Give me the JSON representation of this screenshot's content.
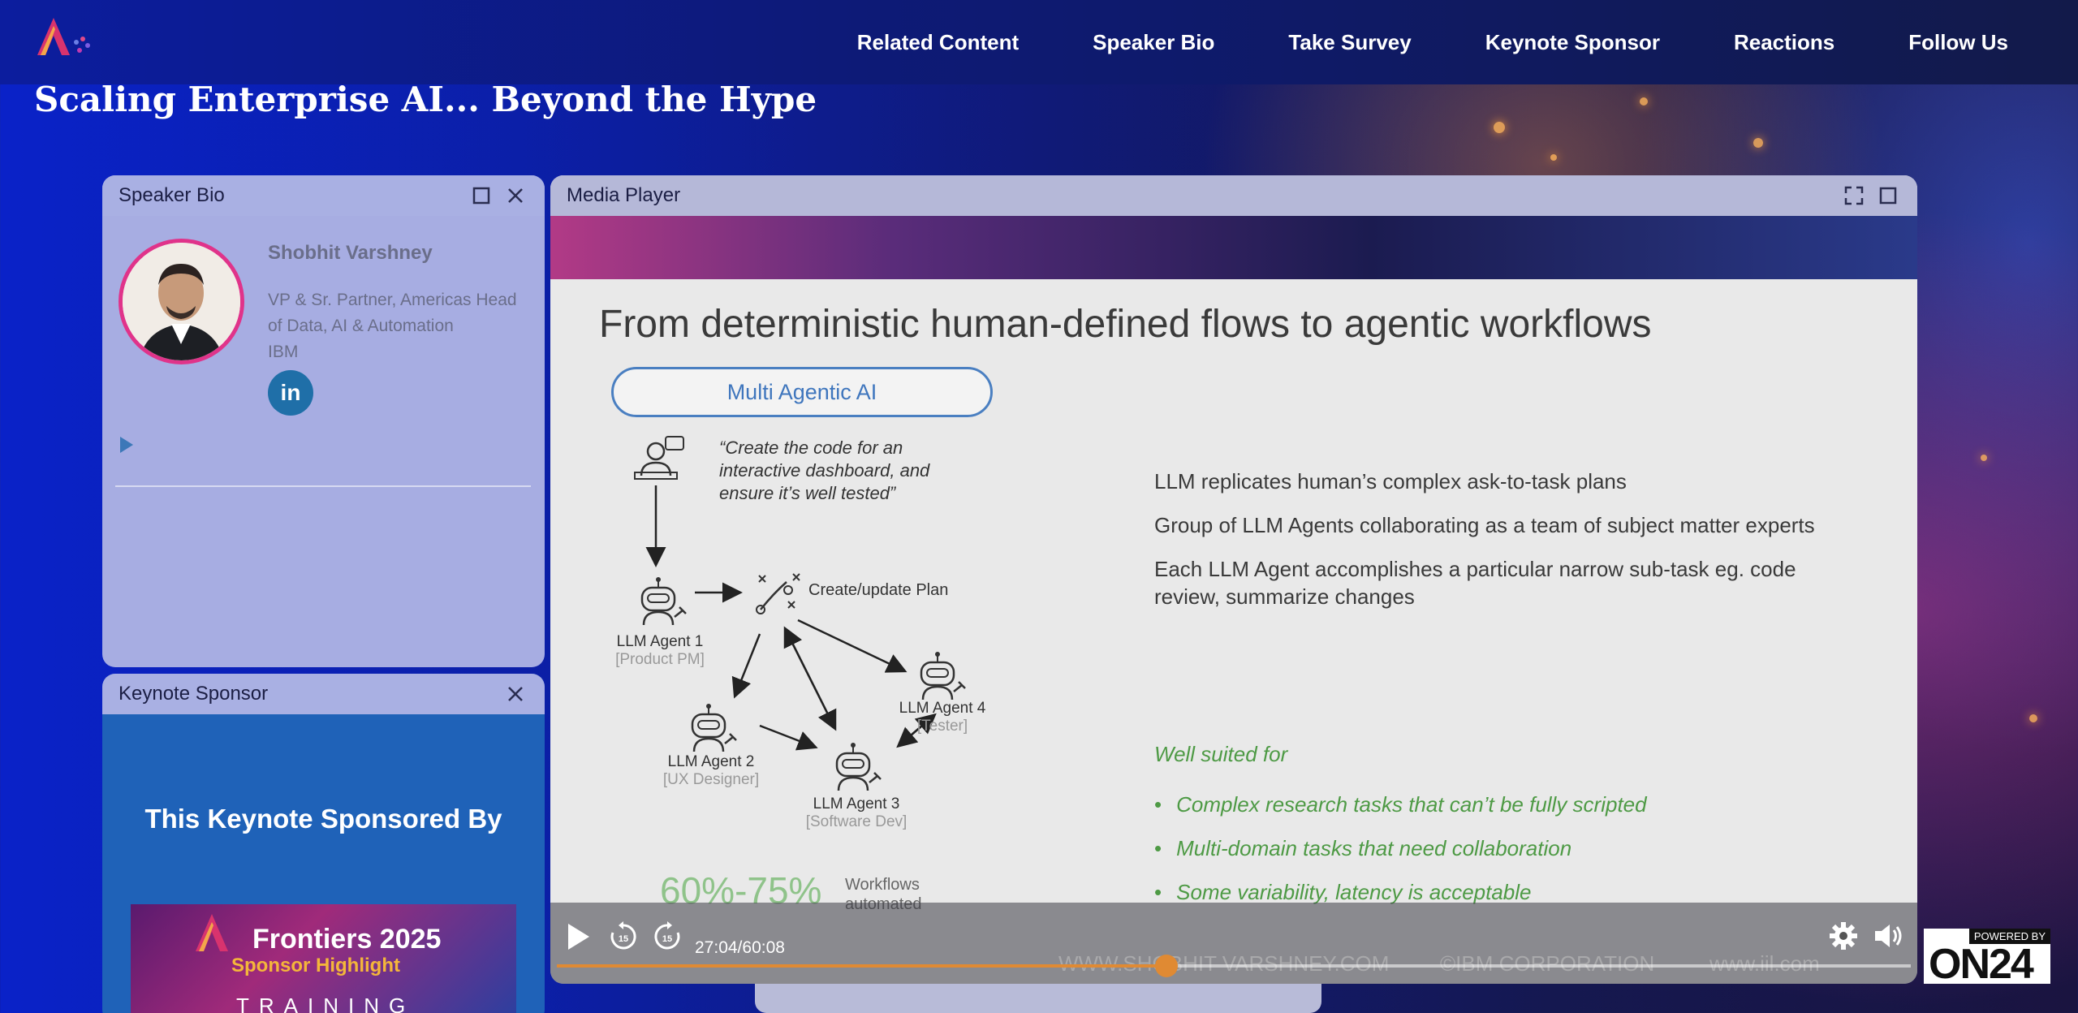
{
  "nav": {
    "items": [
      "Related Content",
      "Speaker Bio",
      "Take Survey",
      "Keynote Sponsor",
      "Reactions",
      "Follow Us"
    ],
    "logo_icon": "ai-frontiers-logo"
  },
  "page_title": "Scaling Enterprise AI... Beyond the Hype",
  "speaker_panel": {
    "title": "Speaker Bio",
    "name": "Shobhit Varshney",
    "role": "VP & Sr. Partner, Americas Head of Data, AI & Automation",
    "company": "IBM",
    "linkedin_label": "in",
    "accent": "#e0338a"
  },
  "sponsor_panel": {
    "title": "Keynote Sponsor",
    "heading": "This Keynote Sponsored By",
    "banner_title": "Frontiers 2025",
    "banner_subtitle": "Sponsor Highlight",
    "banner_bottom": "TRAINING"
  },
  "media_panel": {
    "title": "Media Player",
    "slide": {
      "title": "From deterministic human-defined flows to agentic workflows",
      "pill": "Multi Agentic AI",
      "quote": "“Create the code for an interactive dashboard, and ensure it’s well tested”",
      "plan_label": "Create/update Plan",
      "agents": [
        {
          "name": "LLM Agent 1",
          "role": "[Product PM]"
        },
        {
          "name": "LLM Agent 2",
          "role": "[UX Designer]"
        },
        {
          "name": "LLM Agent 3",
          "role": "[Software Dev]"
        },
        {
          "name": "LLM Agent 4",
          "role": "[Tester]"
        }
      ],
      "points": [
        "LLM replicates human’s complex ask-to-task plans",
        "Group of LLM Agents collaborating as a team of subject matter experts",
        "Each LLM Agent accomplishes a particular narrow sub-task eg. code review, summarize changes"
      ],
      "well_suited": "Well suited for",
      "well_list": [
        "Complex research tasks that can’t be fully scripted",
        "Multi-domain tasks that need collaboration",
        "Some variability, latency is acceptable"
      ],
      "stat": "60%-75%",
      "stat_label": "Workflows automated",
      "footer": [
        "WWW.SHOBHIT VARSHNEY.COM",
        "©IBM CORPORATION",
        "www.iil.com"
      ]
    },
    "player": {
      "time": "27:04/60:08",
      "progress": 0.45,
      "accent": "#e08a33",
      "skip_back": "15",
      "skip_fwd": "15"
    }
  },
  "branding": {
    "powered_by": "POWERED BY",
    "brand": "ON24"
  }
}
